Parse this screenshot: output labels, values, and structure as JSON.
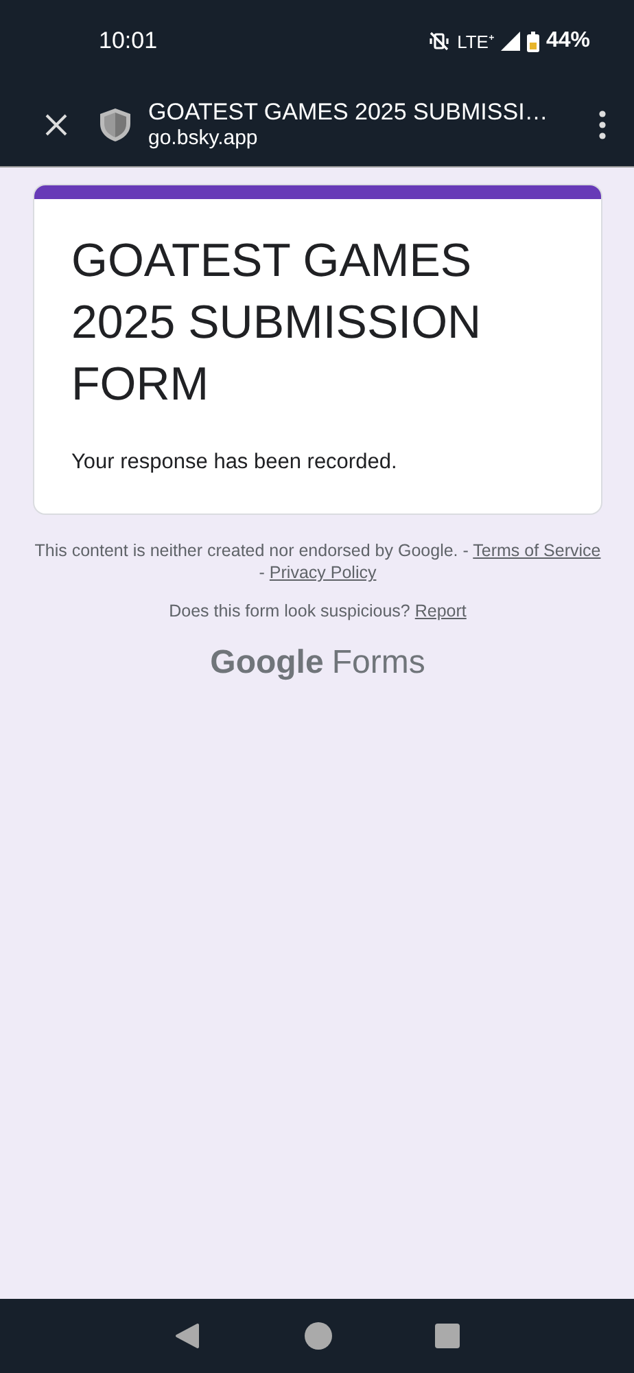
{
  "status_bar": {
    "time": "10:01",
    "network": "LTE⁺",
    "battery": "44%"
  },
  "toolbar": {
    "title": "GOATEST GAMES 2025 SUBMISSI…",
    "url": "go.bsky.app"
  },
  "form": {
    "title": "GOATEST GAMES 2025 SUBMISSION FORM",
    "message": "Your response has been recorded."
  },
  "footer": {
    "disclaimer": "This content is neither created nor endorsed by Google. -",
    "terms_link": "Terms of Service",
    "separator": "-",
    "privacy_link": "Privacy Policy",
    "report_question": "Does this form look suspicious?",
    "report_link": "Report"
  },
  "logo": {
    "brand": "Google",
    "product": "Forms"
  }
}
